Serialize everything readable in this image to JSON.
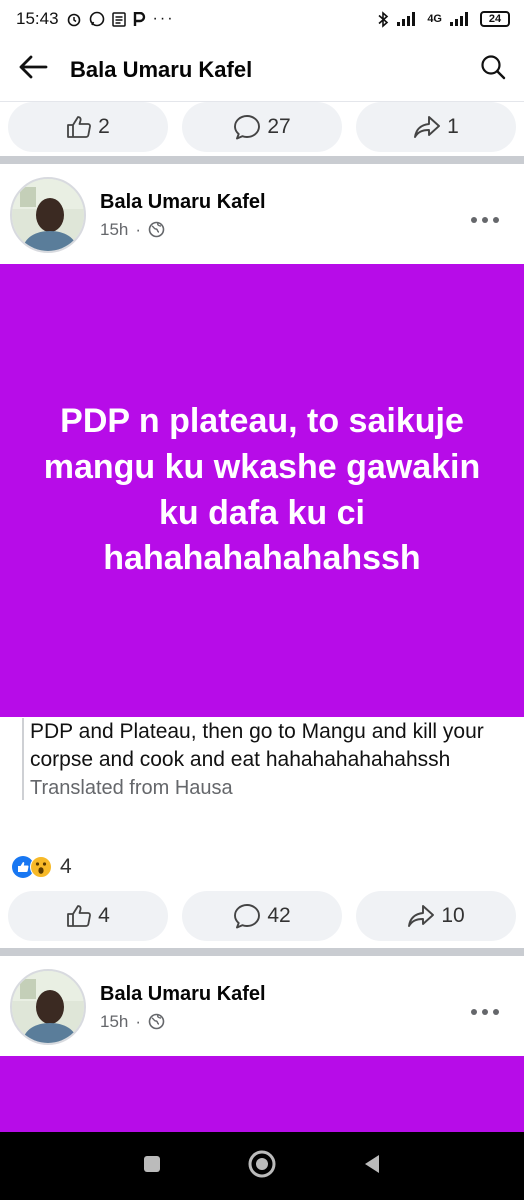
{
  "status_bar": {
    "time": "15:43",
    "network": "4G",
    "battery": "24"
  },
  "header": {
    "title": "Bala Umaru Kafel"
  },
  "top_actions": {
    "likes": "2",
    "comments": "27",
    "shares": "1"
  },
  "post1": {
    "author": "Bala Umaru Kafel",
    "time": "15h",
    "separator": "·",
    "body_text": "PDP n plateau, to saikuje mangu ku wkashe gawakin ku dafa ku ci hahahahahahahssh",
    "background_color": "#b70ce8",
    "translation": "PDP and Plateau, then go to Mangu and kill your corpse and cook and eat hahahahahahahssh",
    "translated_from": "Translated from Hausa",
    "reaction_count": "4",
    "likes": "4",
    "comments": "42",
    "shares": "10"
  },
  "post2": {
    "author": "Bala Umaru Kafel",
    "time": "15h",
    "separator": "·"
  },
  "icons": [
    "back-arrow-icon",
    "search-icon",
    "like-icon",
    "comment-icon",
    "share-icon",
    "globe-icon",
    "more-icon"
  ]
}
